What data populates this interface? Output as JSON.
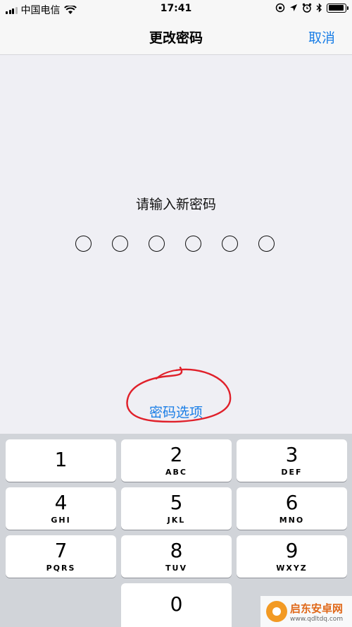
{
  "status": {
    "carrier": "中国电信",
    "time": "17:41",
    "battery_level": 0.95
  },
  "nav": {
    "title": "更改密码",
    "cancel": "取消"
  },
  "prompt": "请输入新密码",
  "passcode_length": 6,
  "options_link": "密码选项",
  "keypad": {
    "k1": {
      "num": "1",
      "letters": ""
    },
    "k2": {
      "num": "2",
      "letters": "ABC"
    },
    "k3": {
      "num": "3",
      "letters": "DEF"
    },
    "k4": {
      "num": "4",
      "letters": "GHI"
    },
    "k5": {
      "num": "5",
      "letters": "JKL"
    },
    "k6": {
      "num": "6",
      "letters": "MNO"
    },
    "k7": {
      "num": "7",
      "letters": "PQRS"
    },
    "k8": {
      "num": "8",
      "letters": "TUV"
    },
    "k9": {
      "num": "9",
      "letters": "WXYZ"
    },
    "k0": {
      "num": "0",
      "letters": ""
    }
  },
  "watermark": {
    "title": "启东安卓网",
    "url": "www.qdltdq.com"
  },
  "colors": {
    "accent": "#1a7ee6",
    "annotation": "#e0202a"
  }
}
